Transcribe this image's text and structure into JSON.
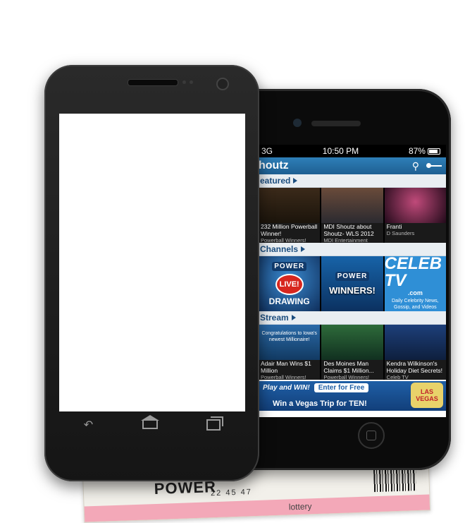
{
  "ticket": {
    "brand": "POWER",
    "numbers": "22 45 47",
    "footer": "lottery"
  },
  "iphone": {
    "status": {
      "carrier": "3G",
      "time": "10:50 PM",
      "battery": "87%"
    },
    "appbar": {
      "brand": "houtz",
      "search_icon": "search-icon",
      "key_icon": "key-icon"
    },
    "sections": {
      "featured": {
        "label": "eatured",
        "items": [
          {
            "title": "232 Million Powerball Winner!",
            "subtitle": "Powerball Winners!"
          },
          {
            "title": "MDI Shoutz about Shoutz- WLS 2012",
            "subtitle": "MDI Entertainment"
          },
          {
            "title": "Franti",
            "subtitle": "D Saunders"
          }
        ]
      },
      "channels": {
        "label": "Channels",
        "items": [
          {
            "logo": "POWER",
            "badge": "LIVE!",
            "caption": "DRAWING"
          },
          {
            "logo": "POWER",
            "caption": "WINNERS!"
          },
          {
            "logo": "CELEB TV",
            "subtitle": ".com",
            "caption": "Daily Celebrity News, Gossip, and Videos"
          }
        ]
      },
      "stream": {
        "label": "Stream",
        "items": [
          {
            "title": "Adair Man Wins $1 Million",
            "subtitle": "Powerball Winners!",
            "overlay": "Congratulations to Iowa's newest Millionaire!"
          },
          {
            "title": "Des Moines Man Claims $1 Million...",
            "subtitle": "Powerball Winners!"
          },
          {
            "title": "Kendra Wilkinson's Holiday Diet Secrets!",
            "subtitle": "Celeb TV"
          }
        ]
      }
    },
    "banner": {
      "play_and_win": "Play and WIN!",
      "enter_button": "Enter for Free",
      "headline": "Win a Vegas Trip for TEN!",
      "vegas_sign": "LAS VEGAS"
    }
  },
  "android": {
    "nav": {
      "back_icon": "back-arrow-icon",
      "home_icon": "home-icon",
      "recent_icon": "recent-apps-icon"
    }
  }
}
